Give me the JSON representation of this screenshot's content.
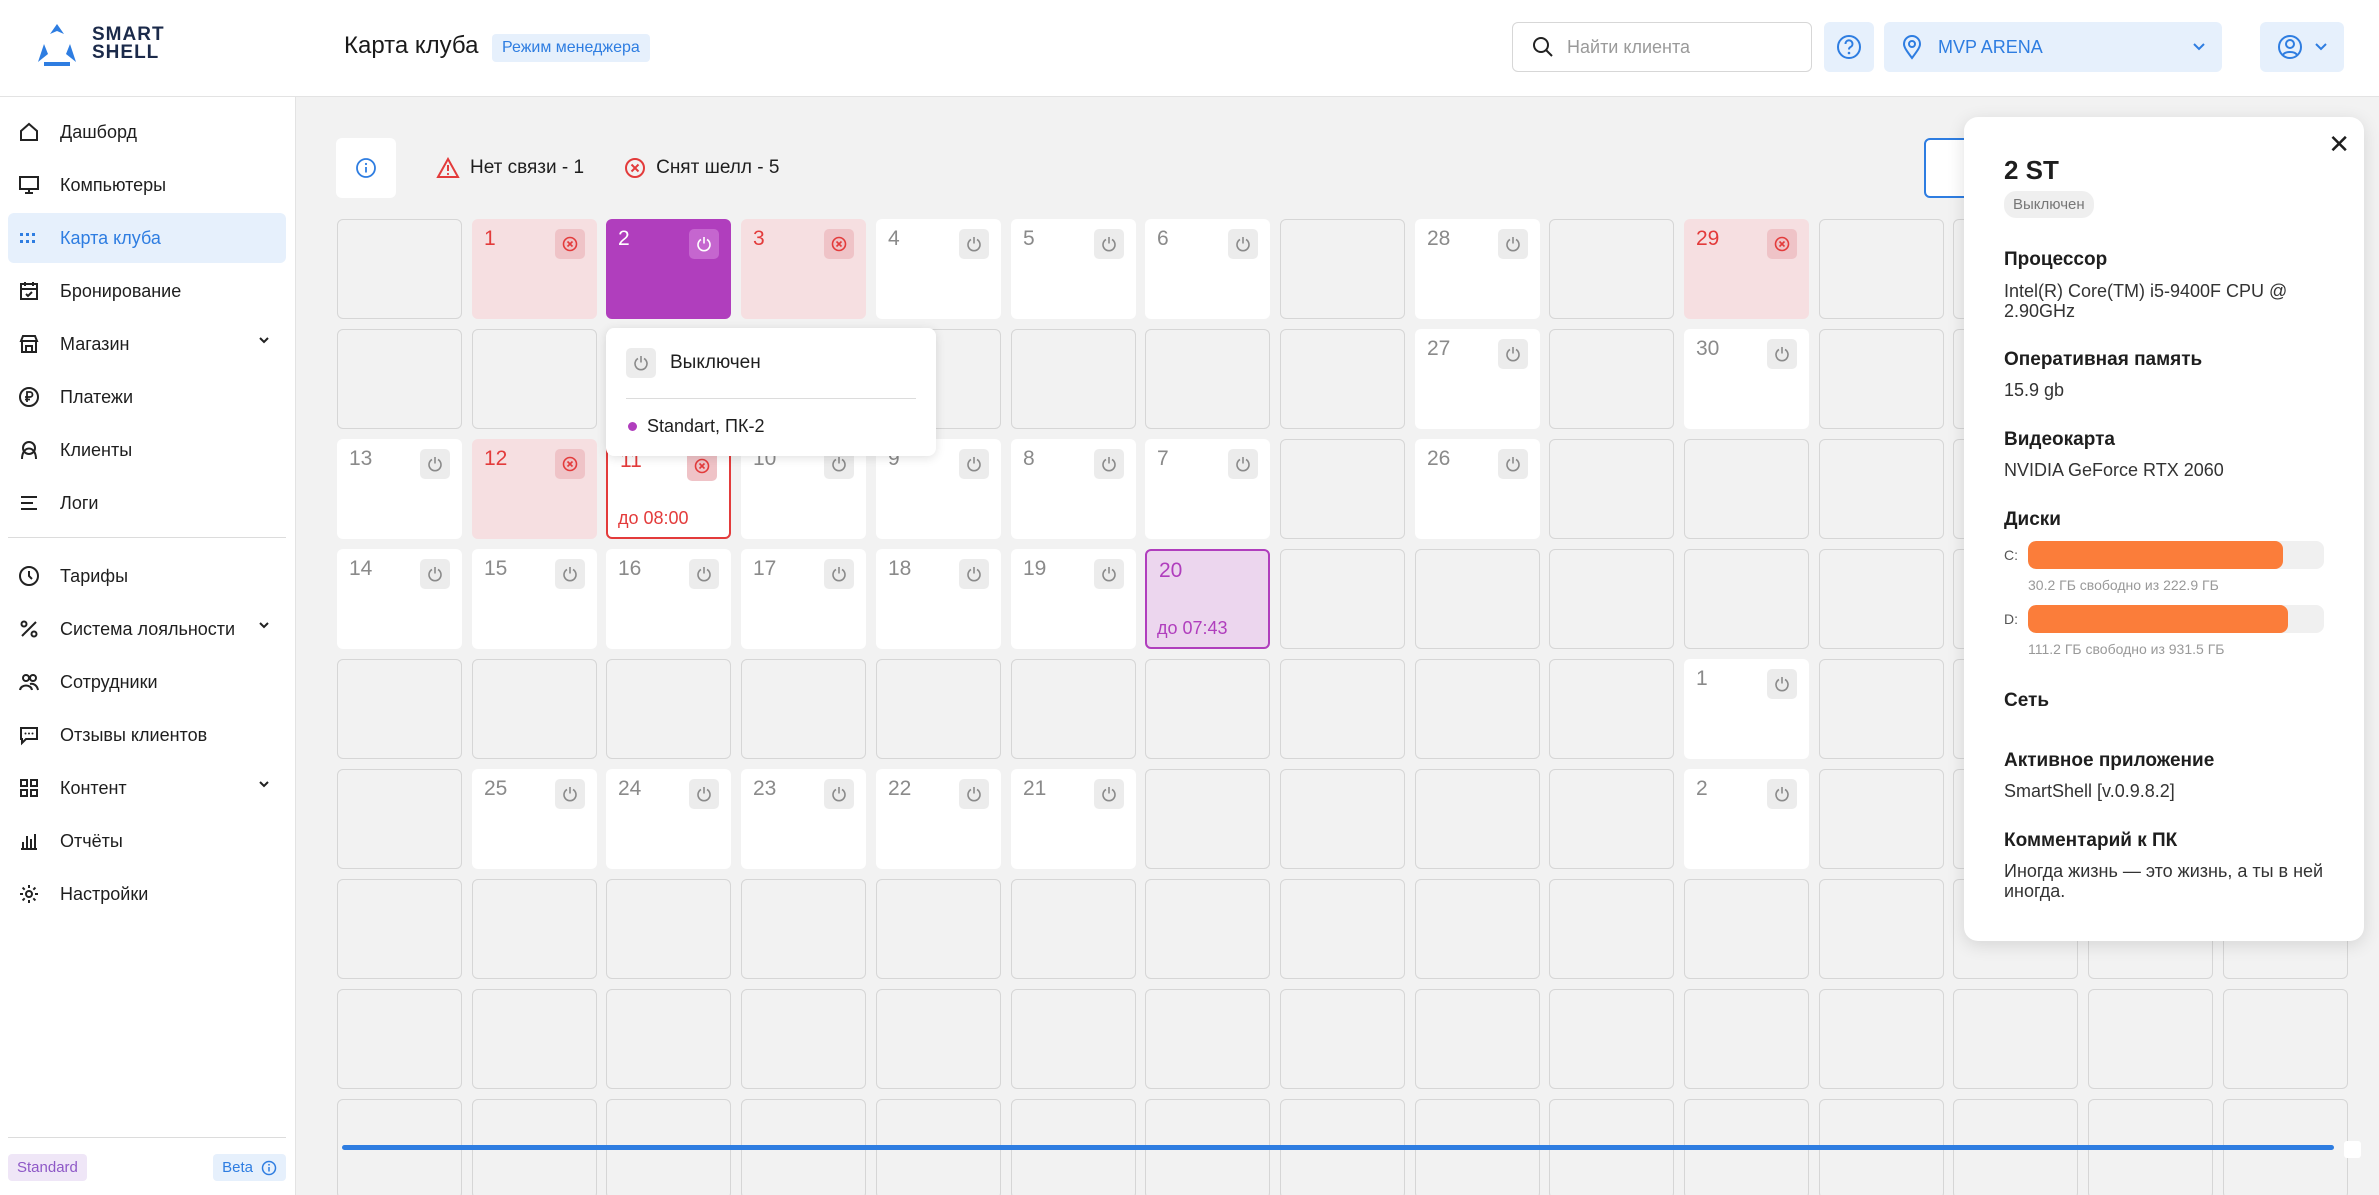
{
  "header": {
    "logo_line1": "SMART",
    "logo_line2": "SHELL",
    "title": "Карта клуба",
    "mode_badge": "Режим менеджера",
    "search_placeholder": "Найти клиента",
    "club_name": "MVP ARENA"
  },
  "sidebar": {
    "items": [
      {
        "label": "Дашборд",
        "icon": "home-icon"
      },
      {
        "label": "Компьютеры",
        "icon": "monitor-icon"
      },
      {
        "label": "Карта клуба",
        "icon": "grid-icon",
        "active": true
      },
      {
        "label": "Бронирование",
        "icon": "calendar-icon"
      },
      {
        "label": "Магазин",
        "icon": "store-icon",
        "expandable": true
      },
      {
        "label": "Платежи",
        "icon": "ruble-icon"
      },
      {
        "label": "Клиенты",
        "icon": "user-face-icon"
      },
      {
        "label": "Логи",
        "icon": "list-icon"
      },
      {
        "label": "Тарифы",
        "icon": "clock-icon"
      },
      {
        "label": "Система лояльности",
        "icon": "percent-icon",
        "expandable": true
      },
      {
        "label": "Сотрудники",
        "icon": "team-icon"
      },
      {
        "label": "Отзывы клиентов",
        "icon": "chat-icon"
      },
      {
        "label": "Контент",
        "icon": "tiles-icon",
        "expandable": true
      },
      {
        "label": "Отчёты",
        "icon": "bar-chart-icon"
      },
      {
        "label": "Настройки",
        "icon": "gear-icon"
      }
    ],
    "plan_badge": "Standard",
    "beta_badge": "Beta"
  },
  "status": {
    "no_connection": "Нет связи - 1",
    "shell_removed": "Снят шелл - 5"
  },
  "map": {
    "cells": [
      {
        "r": 0,
        "c": 1,
        "num": "1",
        "type": "offline"
      },
      {
        "r": 0,
        "c": 2,
        "num": "2",
        "type": "active"
      },
      {
        "r": 0,
        "c": 3,
        "num": "3",
        "type": "offline"
      },
      {
        "r": 0,
        "c": 4,
        "num": "4",
        "type": "pc"
      },
      {
        "r": 0,
        "c": 5,
        "num": "5",
        "type": "pc"
      },
      {
        "r": 0,
        "c": 6,
        "num": "6",
        "type": "pc"
      },
      {
        "r": 0,
        "c": 8,
        "num": "28",
        "type": "pc"
      },
      {
        "r": 0,
        "c": 10,
        "num": "29",
        "type": "offline"
      },
      {
        "r": 1,
        "c": 8,
        "num": "27",
        "type": "pc"
      },
      {
        "r": 1,
        "c": 10,
        "num": "30",
        "type": "pc"
      },
      {
        "r": 2,
        "c": 0,
        "num": "13",
        "type": "pc"
      },
      {
        "r": 2,
        "c": 1,
        "num": "12",
        "type": "offline"
      },
      {
        "r": 2,
        "c": 2,
        "num": "11",
        "type": "red-border",
        "until": "до 08:00"
      },
      {
        "r": 2,
        "c": 3,
        "num": "10",
        "type": "pc"
      },
      {
        "r": 2,
        "c": 4,
        "num": "9",
        "type": "pc"
      },
      {
        "r": 2,
        "c": 5,
        "num": "8",
        "type": "pc"
      },
      {
        "r": 2,
        "c": 6,
        "num": "7",
        "type": "pc"
      },
      {
        "r": 2,
        "c": 8,
        "num": "26",
        "type": "pc"
      },
      {
        "r": 3,
        "c": 0,
        "num": "14",
        "type": "pc"
      },
      {
        "r": 3,
        "c": 1,
        "num": "15",
        "type": "pc"
      },
      {
        "r": 3,
        "c": 2,
        "num": "16",
        "type": "pc"
      },
      {
        "r": 3,
        "c": 3,
        "num": "17",
        "type": "pc"
      },
      {
        "r": 3,
        "c": 4,
        "num": "18",
        "type": "pc"
      },
      {
        "r": 3,
        "c": 5,
        "num": "19",
        "type": "pc"
      },
      {
        "r": 3,
        "c": 6,
        "num": "20",
        "type": "booked",
        "until": "до 07:43"
      },
      {
        "r": 4,
        "c": 10,
        "num": "1",
        "type": "pc"
      },
      {
        "r": 5,
        "c": 1,
        "num": "25",
        "type": "pc"
      },
      {
        "r": 5,
        "c": 2,
        "num": "24",
        "type": "pc"
      },
      {
        "r": 5,
        "c": 3,
        "num": "23",
        "type": "pc"
      },
      {
        "r": 5,
        "c": 4,
        "num": "22",
        "type": "pc"
      },
      {
        "r": 5,
        "c": 5,
        "num": "21",
        "type": "pc"
      },
      {
        "r": 5,
        "c": 10,
        "num": "2",
        "type": "pc"
      }
    ]
  },
  "tooltip": {
    "state": "Выключен",
    "zone": "Standart, ПК-2"
  },
  "panel": {
    "name": "2 ST",
    "state": "Выключен",
    "cpu_label": "Процессор",
    "cpu_value": "Intel(R) Core(TM) i5-9400F CPU @ 2.90GHz",
    "ram_label": "Оперативная память",
    "ram_value": "15.9 gb",
    "gpu_label": "Видеокарта",
    "gpu_value": "NVIDIA GeForce RTX 2060",
    "disks_label": "Диски",
    "disk_c_letter": "C:",
    "disk_c_caption": "30.2 ГБ свободно из 222.9 ГБ",
    "disk_c_used_fraction": 0.86,
    "disk_d_letter": "D:",
    "disk_d_caption": "111.2 ГБ свободно из 931.5 ГБ",
    "disk_d_used_fraction": 0.88,
    "network_label": "Сеть",
    "app_label": "Активное приложение",
    "app_value": "SmartShell [v.0.9.8.2]",
    "comment_label": "Комментарий к ПК",
    "comment_value": "Иногда жизнь — это жизнь, а ты в ней иногда."
  },
  "colors": {
    "accent": "#2e7de1",
    "active_pc": "#b03ebd",
    "offline": "#e33b3b",
    "disk_fill": "#fb7d3a"
  }
}
